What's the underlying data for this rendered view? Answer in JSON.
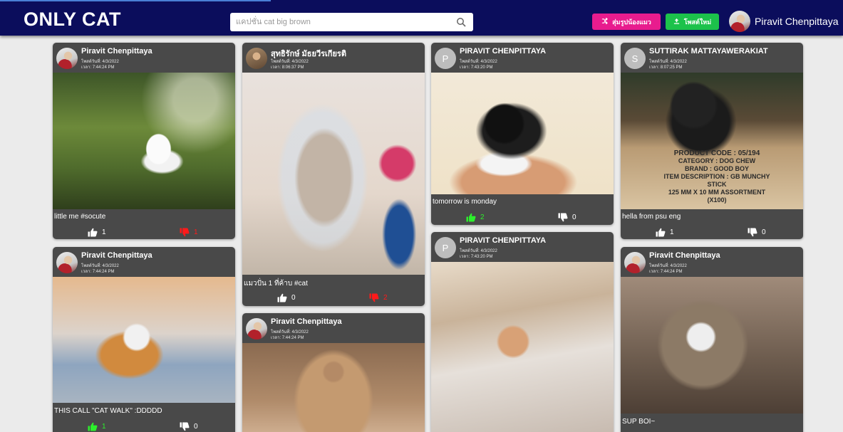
{
  "app": {
    "title": "ONLY CAT",
    "search_placeholder": "แคปชั่น cat big brown",
    "random_button": "สุ่มรูปน้องแมว",
    "post_button": "โพสต์ใหม่",
    "user_name": "Piravit Chenpittaya"
  },
  "colors": {
    "appbar": "#0b0d5c",
    "random_button": "#e81c8e",
    "post_button": "#1cc24b",
    "card": "#494949",
    "like_active": "#2cf02c",
    "dislike_active": "#ff1a1a"
  },
  "icons": {
    "search": "search-icon",
    "random": "shuffle-icon",
    "post": "upload-icon",
    "like": "thumbs-up-icon",
    "dislike": "thumbs-down-icon"
  },
  "posts": [
    {
      "author": "Piravit Chenpittaya",
      "date": "โพสต์วันที่: 4/3/2022",
      "time": "เวลา: 7:44:24 PM",
      "caption": "little me #socute",
      "likes": "1",
      "dislikes": "1"
    },
    {
      "author": "Piravit Chenpittaya",
      "date": "โพสต์วันที่: 4/3/2022",
      "time": "เวลา: 7:44:24 PM",
      "caption": "THIS CALL \"CAT WALK\" :DDDDD",
      "likes": "1",
      "dislikes": "0"
    },
    {
      "author": "สุทธิรักษ์ มัธยวีรเกียรติ",
      "date": "โพสต์วันที่: 4/3/2022",
      "time": "เวลา: 8:06:37 PM",
      "caption": "แมวปั่น 1 ที่ค้าบ #cat",
      "likes": "0",
      "dislikes": "2"
    },
    {
      "author": "Piravit Chenpittaya",
      "date": "โพสต์วันที่: 4/3/2022",
      "time": "เวลา: 7:44:24 PM"
    },
    {
      "author": "PIRAVIT CHENPITTAYA",
      "avatar_letter": "P",
      "date": "โพสต์วันที่: 4/3/2022",
      "time": "เวลา: 7:43:20 PM",
      "caption": "tomorrow is monday",
      "likes": "2",
      "dislikes": "0"
    },
    {
      "author": "PIRAVIT CHENPITTAYA",
      "avatar_letter": "P",
      "date": "โพสต์วันที่: 4/3/2022",
      "time": "เวลา: 7:43:20 PM"
    },
    {
      "author": "SUTTIRAK MATTAYAWERAKIAT",
      "avatar_letter": "S",
      "date": "โพสต์วันที่: 4/3/2022",
      "time": "เวลา: 8:07:25 PM",
      "caption": "hella from psu eng",
      "likes": "1",
      "dislikes": "0",
      "photo_text": [
        "PRODUCT CODE : 05/194",
        "CATEGORY : DOG CHEW",
        "BRAND : GOOD BOY",
        "ITEM DESCRIPTION : GB MUNCHY STICK",
        "125 MM X 10 MM ASSORTMENT (X100)"
      ]
    },
    {
      "author": "Piravit Chenpittaya",
      "date": "โพสต์วันที่: 4/3/2022",
      "time": "เวลา: 7:44:24 PM",
      "caption": "SUP BOI~"
    }
  ]
}
